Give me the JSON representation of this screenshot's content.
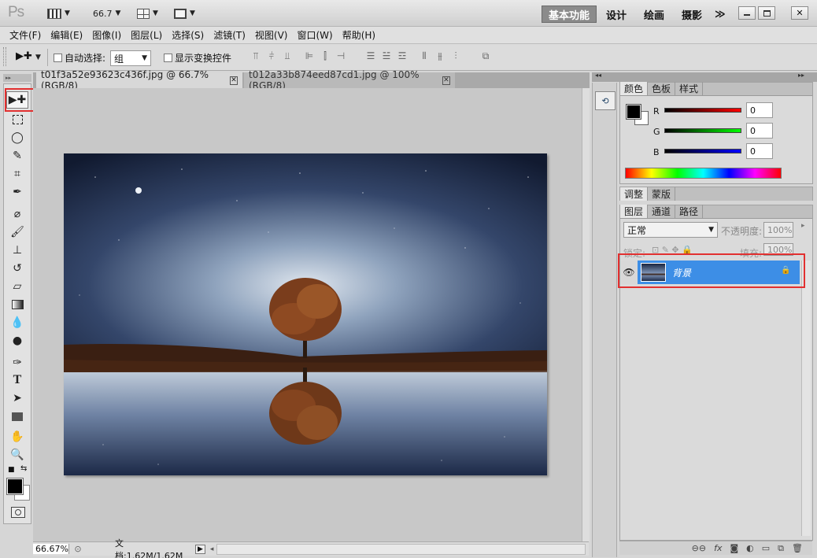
{
  "app": {
    "logo": "Ps",
    "zoom_value": "66.7"
  },
  "workspaces": [
    "基本功能",
    "设计",
    "绘画",
    "摄影"
  ],
  "workspace_more": "≫",
  "menu": [
    "文件(F)",
    "编辑(E)",
    "图像(I)",
    "图层(L)",
    "选择(S)",
    "滤镜(T)",
    "视图(V)",
    "窗口(W)",
    "帮助(H)"
  ],
  "options": {
    "auto_select_label": "自动选择:",
    "auto_select_value": "组",
    "show_transform_label": "显示变换控件"
  },
  "doc_tabs": [
    {
      "label": "t01f3a52e93623c436f.jpg @ 66.7%(RGB/8)"
    },
    {
      "label": "t012a33b874eed87cd1.jpg @ 100%(RGB/8)"
    }
  ],
  "status": {
    "zoom": "66.67%",
    "doc_info": "文档:1.62M/1.62M"
  },
  "color_panel": {
    "tabs": [
      "颜色",
      "色板",
      "样式"
    ],
    "r_label": "R",
    "g_label": "G",
    "b_label": "B",
    "r": "0",
    "g": "0",
    "b": "0"
  },
  "adjust_panel": {
    "tabs": [
      "调整",
      "蒙版"
    ]
  },
  "layers_panel": {
    "tabs": [
      "图层",
      "通道",
      "路径"
    ],
    "blend_mode": "正常",
    "opacity_label": "不透明度:",
    "opacity": "100%",
    "lock_label": "锁定:",
    "fill_label": "填充:",
    "fill": "100%",
    "layers": [
      {
        "name": "背景"
      }
    ]
  },
  "colors": {
    "accent_selection": "#3d8ee6",
    "highlight_box": "#e23030"
  }
}
